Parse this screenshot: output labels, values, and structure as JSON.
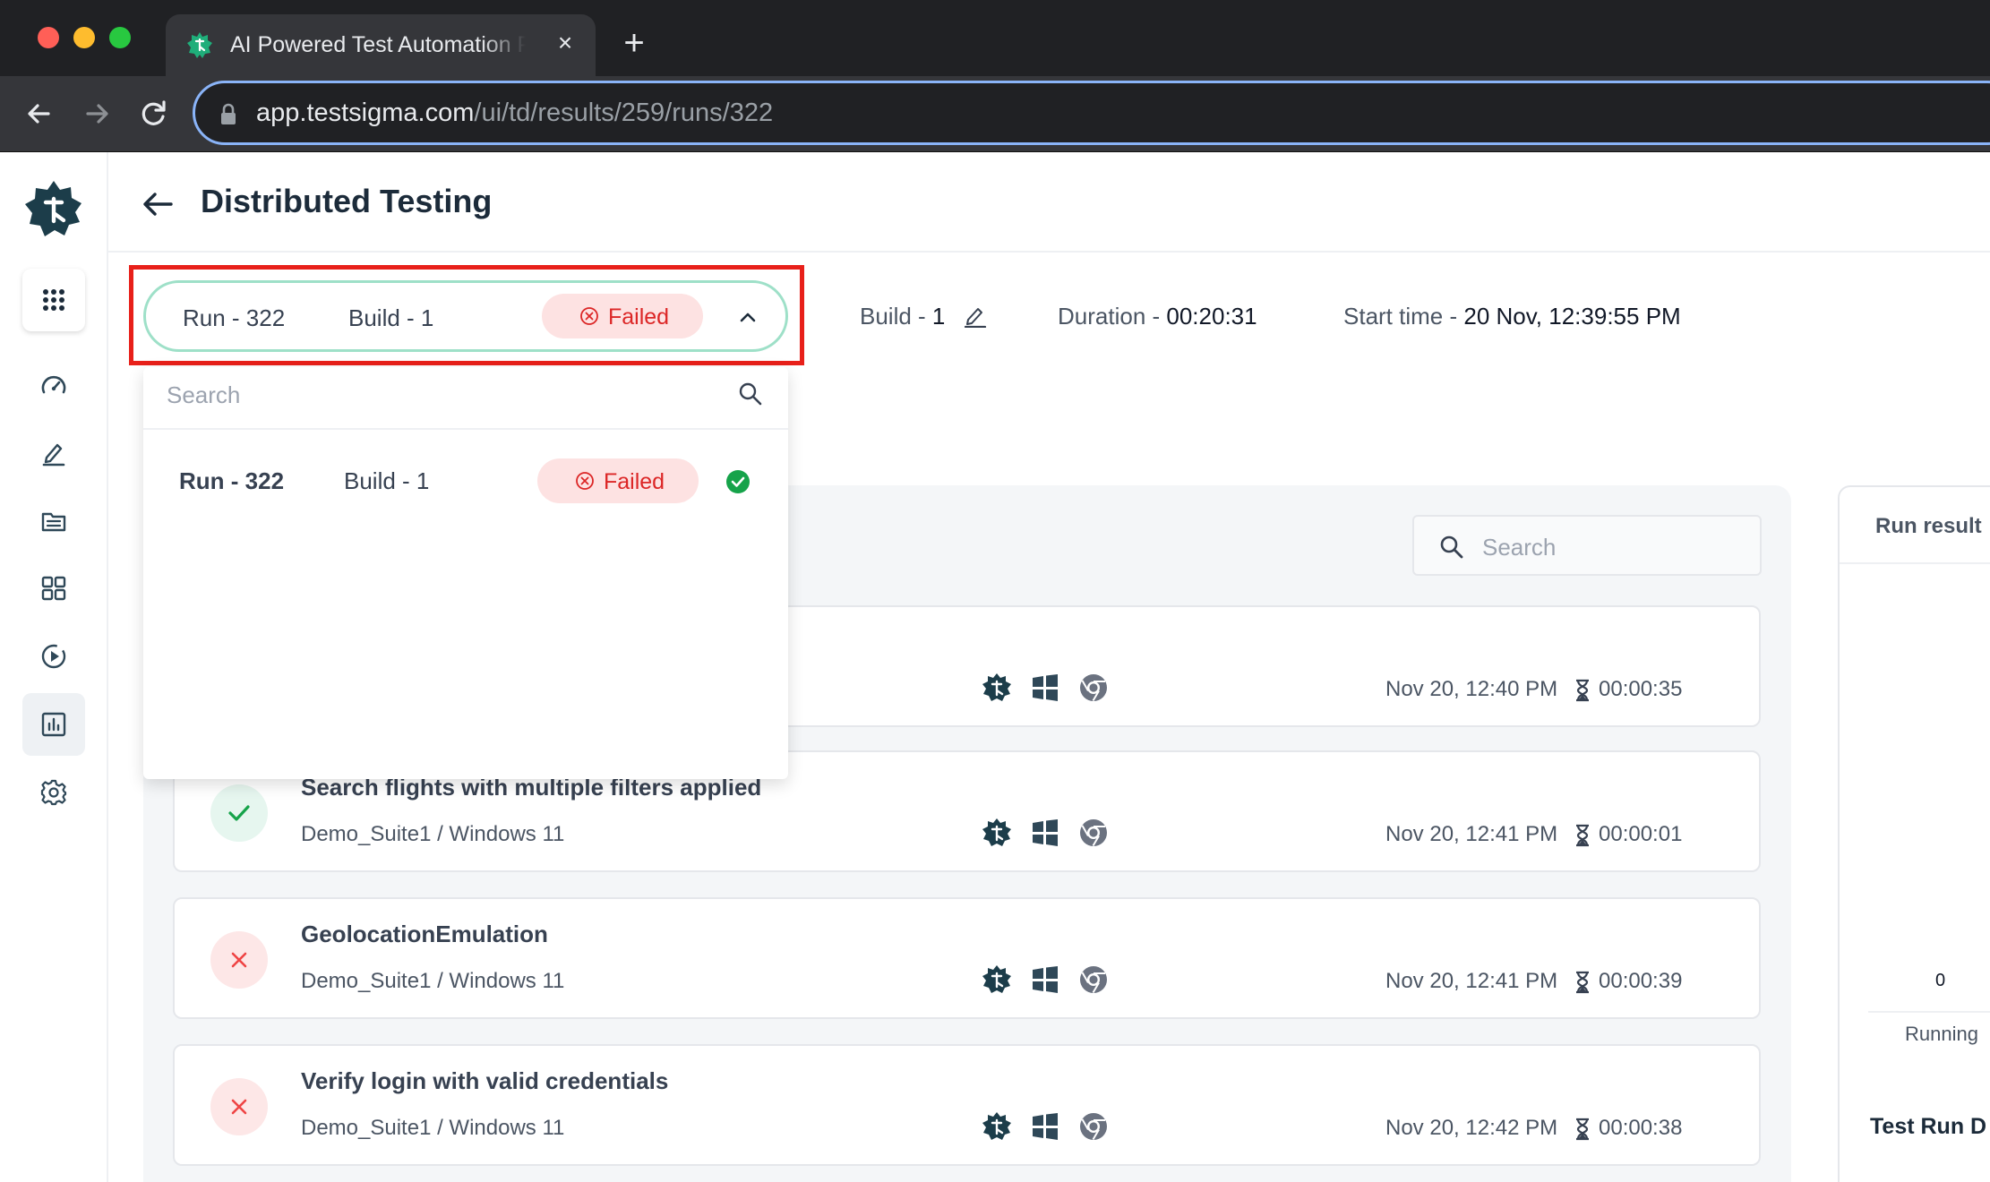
{
  "browser": {
    "tab_title": "AI Powered Test Automation Platform",
    "close_glyph": "×",
    "newtab_glyph": "+",
    "url_host": "app.testsigma.com",
    "url_path": "/ui/td/results/259/runs/322"
  },
  "sidebar": {
    "items": [
      {
        "name": "apps-grid-icon"
      },
      {
        "name": "dashboard-gauge-icon"
      },
      {
        "name": "edit-pen-icon"
      },
      {
        "name": "folder-list-icon"
      },
      {
        "name": "modules-grid-icon"
      },
      {
        "name": "run-play-icon"
      },
      {
        "name": "reports-chart-icon",
        "active": true
      },
      {
        "name": "settings-gear-icon"
      }
    ]
  },
  "header": {
    "title": "Distributed Testing"
  },
  "run_selector": {
    "run_label": "Run - 322",
    "build_label": "Build - 1",
    "status": "Failed",
    "status_color": "#dc2626"
  },
  "meta": {
    "build_label": "Build - ",
    "build_value": "1",
    "duration_label": "Duration - ",
    "duration_value": "00:20:31",
    "start_label": "Start time - ",
    "start_value": "20 Nov, 12:39:55 PM"
  },
  "dropdown": {
    "search_placeholder": "Search",
    "rows": [
      {
        "run": "Run - 322",
        "build": "Build - 1",
        "status": "Failed"
      }
    ]
  },
  "results": {
    "search_placeholder": "Search",
    "cards": [
      {
        "title": "",
        "subtitle": "",
        "status": "hidden",
        "date": "Nov 20, 12:40 PM",
        "duration": "00:00:35"
      },
      {
        "title": "Search flights with multiple filters applied",
        "subtitle": "Demo_Suite1 / Windows 11",
        "status": "pass",
        "date": "Nov 20, 12:41 PM",
        "duration": "00:00:01"
      },
      {
        "title": "GeolocationEmulation",
        "subtitle": "Demo_Suite1 / Windows 11",
        "status": "fail",
        "date": "Nov 20, 12:41 PM",
        "duration": "00:00:39"
      },
      {
        "title": "Verify login with valid credentials",
        "subtitle": "Demo_Suite1 / Windows 11",
        "status": "fail",
        "date": "Nov 20, 12:42 PM",
        "duration": "00:00:38"
      }
    ]
  },
  "right_panel": {
    "title": "Run result",
    "running_count": "0",
    "running_label": "Running",
    "details_title": "Test Run D"
  },
  "colors": {
    "brand": "#1c3d4a",
    "pass": "#16a34a",
    "fail": "#ef4444",
    "highlight": "#e8201a"
  }
}
